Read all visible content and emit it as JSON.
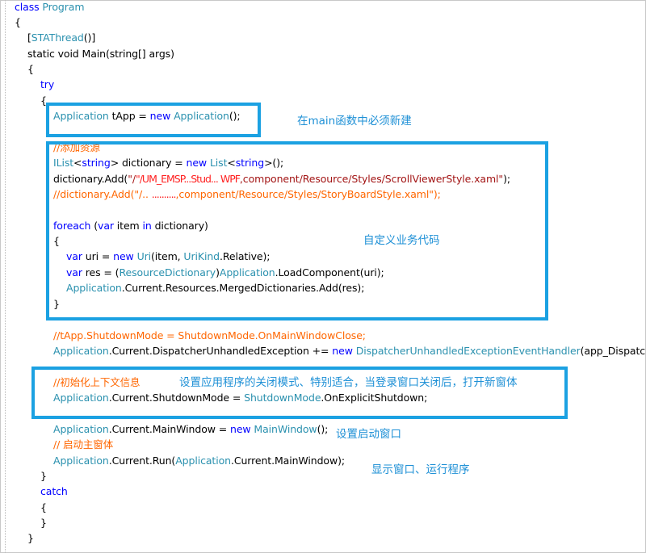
{
  "code": {
    "l01": {
      "a": "class ",
      "b": "Program"
    },
    "l02": "{",
    "l03": {
      "a": "[",
      "b": "STAThread",
      "c": "()]"
    },
    "l04": "static void Main(string[] args)",
    "l05": "{",
    "l06": "try",
    "l07": "{",
    "l08": {
      "a": "Application",
      "b": " tApp = ",
      "c": "new",
      "d": " ",
      "e": "Application",
      "f": "();"
    },
    "l09": "//添加资源",
    "l10": {
      "a": "IList",
      "b": "<",
      "c": "string",
      "d": "> dictionary = ",
      "e": "new",
      "f": " ",
      "g": "List",
      "h": "<",
      "i": "string",
      "j": ">();"
    },
    "l11": {
      "a": "dictionary.Add(",
      "b": "\"/",
      "c": "\"/UM_EMSP...Stud... WPF",
      "d": ",component/Resource/Styles/ScrollViewerStyle.xaml\"",
      "e": ");"
    },
    "l12": {
      "a": "//dictionary.Add(\"/.. ",
      "b": "..........",
      "c": ",component/Resource/Styles/StoryBoardStyle.xaml\");"
    },
    "l13": {
      "a": "foreach",
      "b": " (",
      "c": "var",
      "d": " item ",
      "e": "in",
      "f": " dictionary)"
    },
    "l14": "{",
    "l15": {
      "a": "var",
      "b": " uri = ",
      "c": "new",
      "d": " ",
      "e": "Uri",
      "f": "(item, ",
      "g": "UriKind",
      "h": ".Relative);"
    },
    "l16": {
      "a": "var",
      "b": " res = (",
      "c": "ResourceDictionary",
      "d": ")",
      "e": "Application",
      "f": ".LoadComponent(uri);"
    },
    "l17": {
      "a": "Application",
      "b": ".Current.Resources.MergedDictionaries.Add(res);"
    },
    "l18": "}",
    "l19": "//tApp.ShutdownMode = ShutdownMode.OnMainWindowClose;",
    "l20": {
      "a": "Application",
      "b": ".Current.DispatcherUnhandledException += ",
      "c": "new",
      "d": " ",
      "e": "DispatcherUnhandledExceptionEventHandler",
      "f": "(app_DispatcherU"
    },
    "l21": "//初始化上下文信息",
    "l22": {
      "a": "Application",
      "b": ".Current.ShutdownMode = ",
      "c": "ShutdownMode",
      "d": ".OnExplicitShutdown;"
    },
    "l23": {
      "a": "Application",
      "b": ".Current.MainWindow = ",
      "c": "new",
      "d": " ",
      "e": "MainWindow",
      "f": "();"
    },
    "l24": "// 启动主窗体",
    "l25": {
      "a": "Application",
      "b": ".Current.Run(",
      "c": "Application",
      "d": ".Current.MainWindow);"
    },
    "l26": "}",
    "l27": "catch",
    "l28": "{",
    "l29": "}",
    "l30": "}"
  },
  "annotations": {
    "new_in_main": "在main函数中必须新建",
    "custom_business": "自定义业务代码",
    "shutdown_mode": "设置应用程序的关闭模式、特别适合，当登录窗口关闭后，打开新窗体",
    "startup_window": "设置启动窗口",
    "show_window": "显示窗口、运行程序"
  },
  "colors": {
    "keyword": "#0000ff",
    "type": "#2b91af",
    "string": "#a31515",
    "comment": "#ff6600",
    "highlight_box": "#1ba1e2",
    "annotation": "#1e90d6"
  }
}
